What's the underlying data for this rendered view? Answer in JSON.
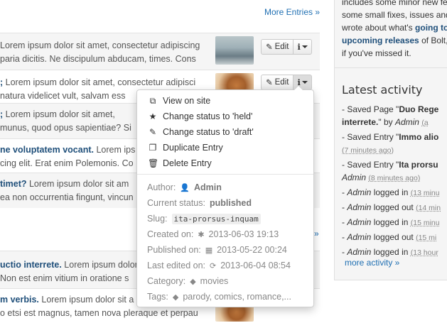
{
  "list": {
    "more_entries": "More Entries »",
    "rows": [
      {
        "bold": "",
        "text": "Lorem ipsum dolor sit amet, consectetur adipiscing",
        "line2": "paria dicitis. Ne discipulum abducam, times. Cons"
      },
      {
        "bold": ";",
        "text": " Lorem ipsum dolor sit amet, consectetur adipisci",
        "line2": "natura videlicet vult, salvam ess"
      },
      {
        "bold": ";",
        "text": " Lorem ipsum dolor sit amet,",
        "line2": "munus, quod opus sapientiae? Si"
      },
      {
        "bold": "ne voluptatem vocant.",
        "text": " Lorem ips",
        "line2": "cing elit. Erat enim Polemonis. Co"
      },
      {
        "bold": " timet?",
        "text": " Lorem ipsum dolor sit am",
        "line2": "ea non occurrentia fingunt, vincun"
      },
      {
        "bold": "uctio interrete.",
        "text": " Lorem ipsum dolor",
        "line2": "Non est enim vitium in oratione s"
      },
      {
        "bold": "m verbis.",
        "text": " Lorem ipsum dolor sit a",
        "line2": "o etsi est magnus, tamen nova pleraque et perpau"
      }
    ],
    "edit_label": "Edit"
  },
  "sidebar": {
    "news_line1": "includes some minor new fe",
    "news_line2": "some small fixes, issues and",
    "news_line3": "wrote about what's",
    "news_link1": "going to",
    "news_link2": "upcoming releases",
    "news_line4": "of Bolt,",
    "news_line5": "if you've missed it.",
    "latest_title": "Latest activity",
    "activity": [
      {
        "pre": "- Saved Page \"",
        "bold": "Duo Rege",
        "line2_bold": "interrete.",
        "line2": "\" by ",
        "user": "Admin",
        "ago": "(a"
      },
      {
        "pre": "- Saved Entry \"",
        "bold": "Immo alio",
        "ago": "(7 minutes ago)"
      },
      {
        "pre": "- Saved Entry \"",
        "bold": "Ita prorsu",
        "user": "Admin",
        "ago": "(8 minutes ago)"
      },
      {
        "pre": "- ",
        "user": "Admin",
        "action": " logged in ",
        "ago": "(13 minu"
      },
      {
        "pre": "- ",
        "user": "Admin",
        "action": " logged out ",
        "ago": "(14 min"
      },
      {
        "pre": "- ",
        "user": "Admin",
        "action": " logged in ",
        "ago": "(15 minu"
      },
      {
        "pre": "- ",
        "user": "Admin",
        "action": " logged out ",
        "ago": "(15 mi"
      },
      {
        "pre": "- ",
        "user": "Admin",
        "action": " logged in ",
        "ago": "(13 hour"
      }
    ],
    "more_activity": "more activity »"
  },
  "dropdown": {
    "actions": [
      {
        "icon": "external-link-icon",
        "glyph": "⧉",
        "label": "View on site"
      },
      {
        "icon": "star-icon",
        "glyph": "★",
        "label": "Change status to 'held'"
      },
      {
        "icon": "pencil-icon",
        "glyph": "✎",
        "label": "Change status to 'draft'"
      },
      {
        "icon": "copy-icon",
        "glyph": "❐",
        "label": "Duplicate Entry"
      },
      {
        "icon": "trash-icon",
        "glyph": "🗑",
        "label": "Delete Entry"
      }
    ],
    "meta": {
      "author_label": "Author:",
      "author": "Admin",
      "status_label": "Current status:",
      "status": "published",
      "slug_label": "Slug:",
      "slug": "ita-prorsus-inquam",
      "created_label": "Created on:",
      "created": "2013-06-03 19:13",
      "published_label": "Published on:",
      "published": "2013-05-22 00:24",
      "edited_label": "Last edited on:",
      "edited": "2013-06-04 08:54",
      "category_label": "Category:",
      "category": "movies",
      "tags_label": "Tags:",
      "tags": "parody, comics, romance,..."
    }
  }
}
